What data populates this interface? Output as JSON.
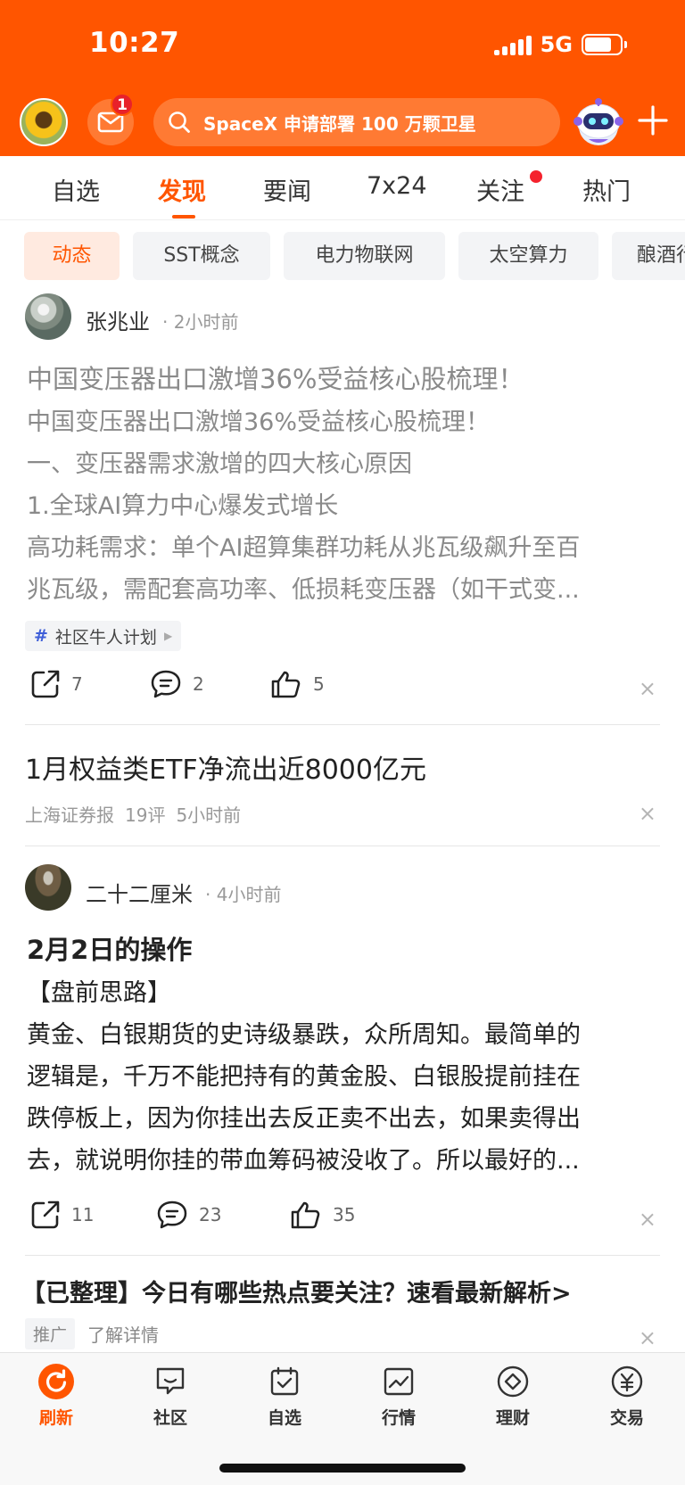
{
  "status_bar": {
    "time": "10:27",
    "network": "5G"
  },
  "header": {
    "mail_badge": "1",
    "search_placeholder": "SpaceX 申请部署 100 万颗卫星",
    "accent_color": "#ff5500"
  },
  "tabs": [
    {
      "label": "自选"
    },
    {
      "label": "发现",
      "active": true
    },
    {
      "label": "要闻"
    },
    {
      "label": "7x24"
    },
    {
      "label": "关注",
      "has_dot": true
    },
    {
      "label": "热门"
    }
  ],
  "chips": [
    {
      "label": "动态",
      "active": true
    },
    {
      "label": "SST概念"
    },
    {
      "label": "电力物联网"
    },
    {
      "label": "太空算力"
    },
    {
      "label": "酿酒行"
    }
  ],
  "feed": {
    "post1": {
      "author": "张兆业",
      "time": "· 2小时前",
      "title": "中国变压器出口激增36%受益核心股梳理！",
      "lines": [
        "中国变压器出口激增36%受益核心股梳理！",
        "一、变压器需求激增的四大核心原因",
        "1.全球AI算力中心爆发式增长",
        "高功耗需求：单个AI超算集群功耗从兆瓦级飙升至百",
        "兆瓦级，需配套高功率、低损耗变压器（如干式变..."
      ],
      "topic": "社区牛人计划",
      "shares": "7",
      "comments": "2",
      "likes": "5"
    },
    "news1": {
      "title": "1月权益类ETF净流出近8000亿元",
      "source": "上海证券报",
      "comments": "19评",
      "time": "5小时前"
    },
    "post2": {
      "author": "二十二厘米",
      "time": "· 4小时前",
      "title": "2月2日的操作",
      "lines": [
        "【盘前思路】",
        "黄金、白银期货的史诗级暴跌，众所周知。最简单的",
        "逻辑是，千万不能把持有的黄金股、白银股提前挂在",
        "跌停板上，因为你挂出去反正卖不出去，如果卖得出",
        "去，就说明你挂的带血筹码被没收了。所以最好的..."
      ],
      "shares": "11",
      "comments": "23",
      "likes": "35"
    },
    "promo": {
      "title": "【已整理】今日有哪些热点要关注？速看最新解析>",
      "tag": "推广",
      "link": "了解详情"
    },
    "close_symbol": "×"
  },
  "bottom_nav": [
    {
      "label": "刷新",
      "icon": "refresh-icon",
      "active": true
    },
    {
      "label": "社区",
      "icon": "community-icon"
    },
    {
      "label": "自选",
      "icon": "watchlist-icon"
    },
    {
      "label": "行情",
      "icon": "market-icon"
    },
    {
      "label": "理财",
      "icon": "wealth-icon"
    },
    {
      "label": "交易",
      "icon": "trade-icon"
    }
  ]
}
